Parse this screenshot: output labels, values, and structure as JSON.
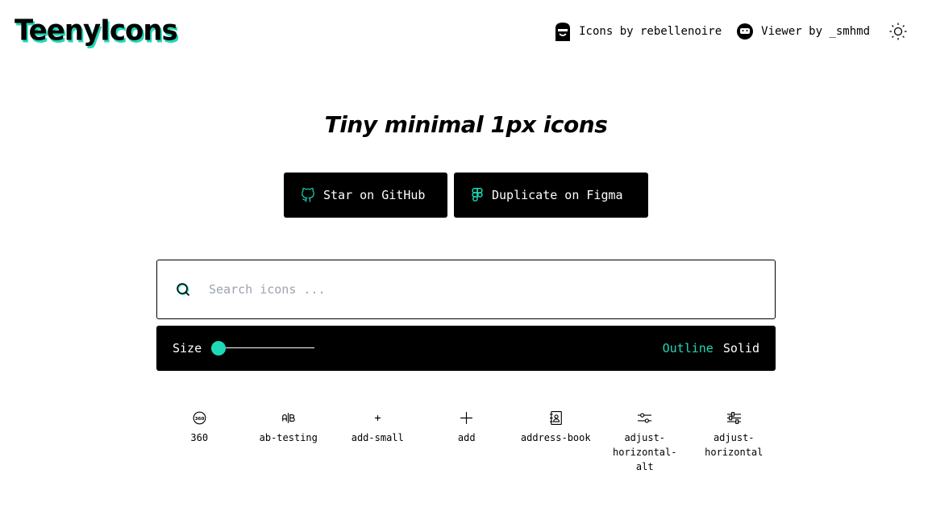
{
  "header": {
    "logo": "TeenyIcons",
    "credits": [
      {
        "label": "Icons by rebellenoire",
        "icon": "avatar-rebellenoire-icon"
      },
      {
        "label": "Viewer by _smhmd",
        "icon": "avatar-smhmd-icon"
      }
    ],
    "theme_toggle_icon": "sun-icon"
  },
  "hero": {
    "tagline": "Tiny minimal 1px icons",
    "buttons": [
      {
        "label": "Star on GitHub",
        "icon": "github-icon"
      },
      {
        "label": "Duplicate on Figma",
        "icon": "figma-icon"
      }
    ]
  },
  "search": {
    "placeholder": "Search icons ...",
    "value": ""
  },
  "toolbar": {
    "size_label": "Size",
    "size_value_fraction": 0,
    "variants": [
      "Outline",
      "Solid"
    ],
    "active_variant": "Outline"
  },
  "colors": {
    "accent": "#1fd8b7",
    "dark": "#000000",
    "background": "#ffffff",
    "placeholder": "#9ca3af"
  },
  "icons": [
    {
      "name": "360"
    },
    {
      "name": "ab-testing"
    },
    {
      "name": "add-small"
    },
    {
      "name": "add"
    },
    {
      "name": "address-book"
    },
    {
      "name": "adjust-horizontal-alt"
    },
    {
      "name": "adjust-horizontal"
    }
  ]
}
